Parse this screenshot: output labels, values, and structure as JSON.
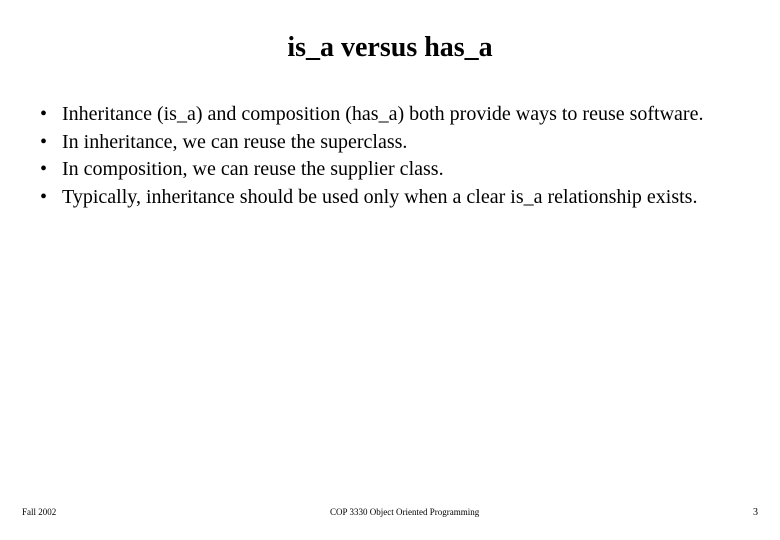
{
  "slide": {
    "title": "is_a versus has_a",
    "bullets": [
      "Inheritance (is_a) and composition (has_a) both provide ways to reuse software.",
      "In inheritance, we can reuse the superclass.",
      "In composition, we can reuse the supplier class.",
      "Typically, inheritance should be used only when a clear is_a relationship exists."
    ],
    "footer": {
      "left": "Fall 2002",
      "center": "COP 3330 Object Oriented Programming",
      "right": "3"
    }
  }
}
